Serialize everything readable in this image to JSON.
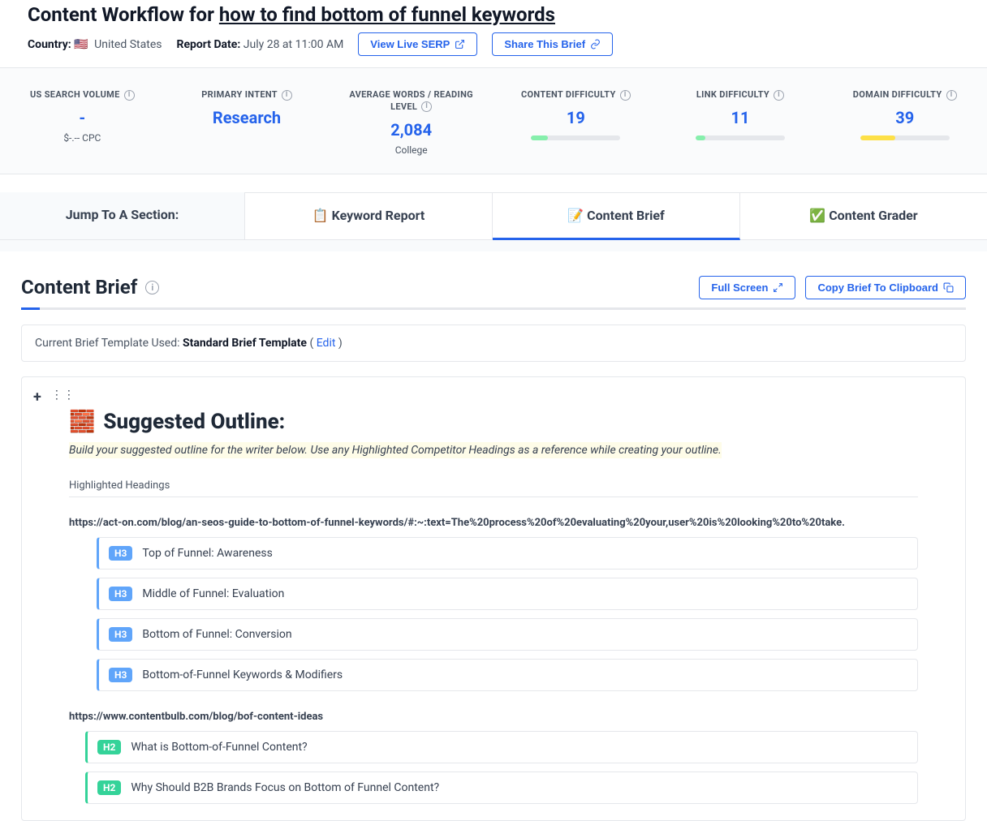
{
  "header": {
    "title_prefix": "Content Workflow for ",
    "keyword": "how to find bottom of funnel keywords",
    "country_label": "Country:",
    "country_flag": "🇺🇸",
    "country_value": "United States",
    "date_label": "Report Date:",
    "date_value": "July 28 at 11:00 AM",
    "view_serp": "View Live SERP",
    "share_brief": "Share This Brief"
  },
  "stats": {
    "volume": {
      "label": "US SEARCH VOLUME",
      "value": "-",
      "sub": "$-.-- CPC"
    },
    "intent": {
      "label": "PRIMARY INTENT",
      "value": "Research"
    },
    "words": {
      "label": "AVERAGE WORDS / READING LEVEL",
      "value": "2,084",
      "sub": "College"
    },
    "content_diff": {
      "label": "CONTENT DIFFICULTY",
      "value": "19",
      "pct": 19,
      "color": "#86efac"
    },
    "link_diff": {
      "label": "LINK DIFFICULTY",
      "value": "11",
      "pct": 11,
      "color": "#86efac"
    },
    "domain_diff": {
      "label": "DOMAIN DIFFICULTY",
      "value": "39",
      "pct": 39,
      "color": "#fde047"
    }
  },
  "tabs": {
    "jump": "Jump To A Section:",
    "keyword": "📋 Keyword Report",
    "brief": "📝 Content Brief",
    "grader": "✅ Content Grader"
  },
  "section": {
    "title": "Content Brief",
    "full_screen": "Full Screen",
    "copy": "Copy Brief To Clipboard",
    "progress_pct": 2
  },
  "template": {
    "prefix": "Current Brief Template Used: ",
    "name": "Standard Brief Template",
    "edit": "Edit"
  },
  "outline": {
    "heading": "Suggested Outline:",
    "emoji": "🧱",
    "hint": "Build your suggested outline for the writer below. Use any Highlighted Competitor Headings as a reference while creating your outline.",
    "hh_label": "Highlighted Headings",
    "sources": [
      {
        "url": "https://act-on.com/blog/an-seos-guide-to-bottom-of-funnel-keywords/#:~:text=The%20process%20of%20evaluating%20your,user%20is%20looking%20to%20take.",
        "headings": [
          {
            "level": "H3",
            "text": "Top of Funnel: Awareness"
          },
          {
            "level": "H3",
            "text": "Middle of Funnel: Evaluation"
          },
          {
            "level": "H3",
            "text": "Bottom of Funnel: Conversion"
          },
          {
            "level": "H3",
            "text": "Bottom-of-Funnel Keywords & Modifiers"
          }
        ]
      },
      {
        "url": "https://www.contentbulb.com/blog/bof-content-ideas",
        "headings": [
          {
            "level": "H2",
            "text": "What is Bottom-of-Funnel Content?"
          },
          {
            "level": "H2",
            "text": "Why Should B2B Brands Focus on Bottom of Funnel Content?"
          }
        ]
      }
    ]
  }
}
